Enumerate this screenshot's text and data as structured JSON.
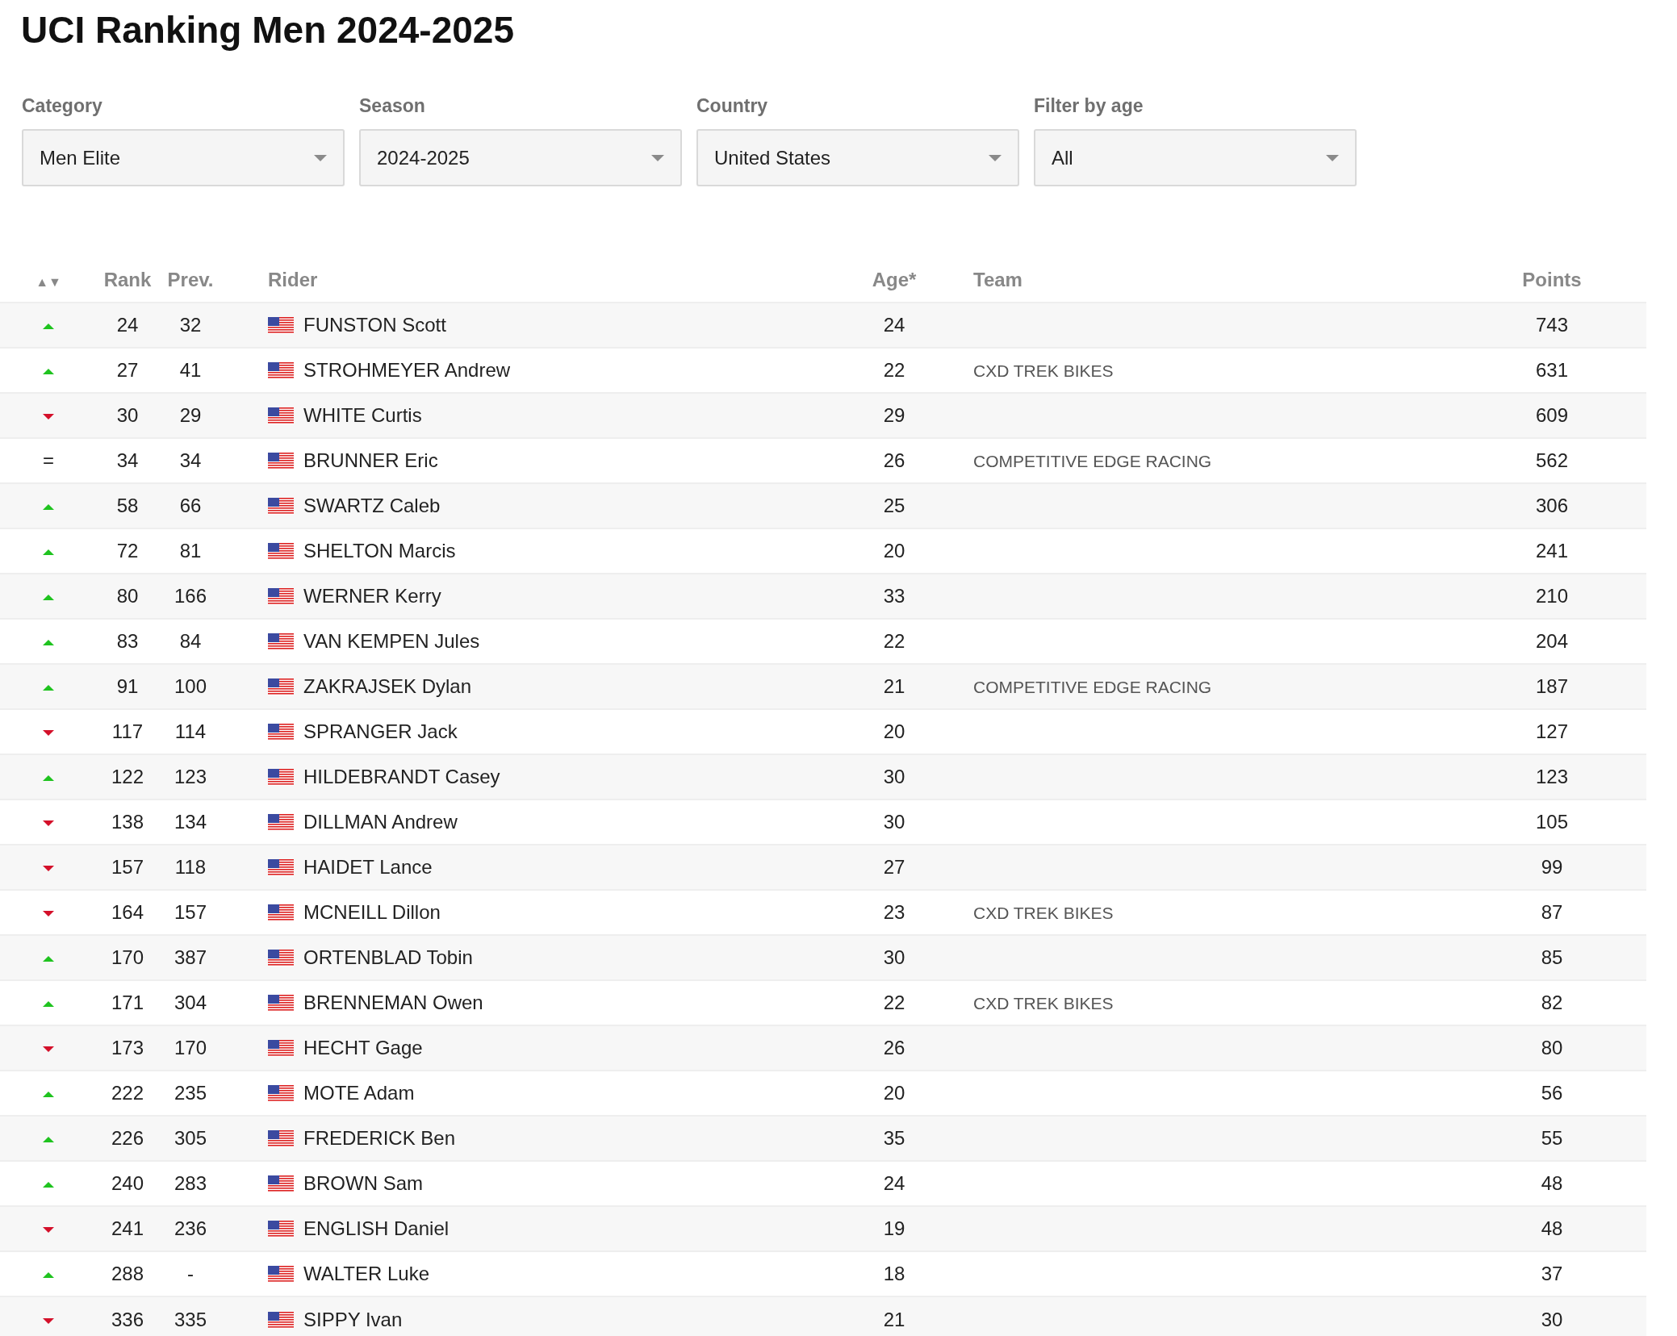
{
  "title": "UCI Ranking Men 2024-2025",
  "filters": [
    {
      "label": "Category",
      "value": "Men Elite"
    },
    {
      "label": "Season",
      "value": "2024-2025"
    },
    {
      "label": "Country",
      "value": "United States"
    },
    {
      "label": "Filter by age",
      "value": "All"
    }
  ],
  "table": {
    "columns": [
      "▲▼",
      "Rank",
      "Prev.",
      "Rider",
      "Age*",
      "Team",
      "Points"
    ],
    "rows": [
      {
        "kind": "up",
        "rank": "24",
        "prev": "32",
        "rider": "FUNSTON Scott",
        "age": "24",
        "points": "743"
      },
      {
        "kind": "up",
        "rank": "27",
        "prev": "41",
        "rider": "STROHMEYER Andrew",
        "age": "22",
        "team": "CXD TREK BIKES",
        "points": "631"
      },
      {
        "kind": "down",
        "rank": "30",
        "prev": "29",
        "rider": "WHITE Curtis",
        "age": "29",
        "points": "609"
      },
      {
        "kind": "equal",
        "trend_text": "=",
        "rank": "34",
        "prev": "34",
        "rider": "BRUNNER Eric",
        "age": "26",
        "team": "COMPETITIVE EDGE RACING",
        "points": "562"
      },
      {
        "kind": "up",
        "rank": "58",
        "prev": "66",
        "rider": "SWARTZ Caleb",
        "age": "25",
        "points": "306"
      },
      {
        "kind": "up",
        "rank": "72",
        "prev": "81",
        "rider": "SHELTON Marcis",
        "age": "20",
        "points": "241"
      },
      {
        "kind": "up",
        "rank": "80",
        "prev": "166",
        "rider": "WERNER Kerry",
        "age": "33",
        "points": "210"
      },
      {
        "kind": "up",
        "rank": "83",
        "prev": "84",
        "rider": "VAN KEMPEN Jules",
        "age": "22",
        "points": "204"
      },
      {
        "kind": "up",
        "rank": "91",
        "prev": "100",
        "rider": "ZAKRAJSEK Dylan",
        "age": "21",
        "team": "COMPETITIVE EDGE RACING",
        "points": "187"
      },
      {
        "kind": "down",
        "rank": "117",
        "prev": "114",
        "rider": "SPRANGER Jack",
        "age": "20",
        "points": "127"
      },
      {
        "kind": "up",
        "rank": "122",
        "prev": "123",
        "rider": "HILDEBRANDT Casey",
        "age": "30",
        "points": "123"
      },
      {
        "kind": "down",
        "rank": "138",
        "prev": "134",
        "rider": "DILLMAN Andrew",
        "age": "30",
        "points": "105"
      },
      {
        "kind": "down",
        "rank": "157",
        "prev": "118",
        "rider": "HAIDET Lance",
        "age": "27",
        "points": "99"
      },
      {
        "kind": "down",
        "rank": "164",
        "prev": "157",
        "rider": "MCNEILL Dillon",
        "age": "23",
        "team": "CXD TREK BIKES",
        "points": "87"
      },
      {
        "kind": "up",
        "rank": "170",
        "prev": "387",
        "rider": "ORTENBLAD Tobin",
        "age": "30",
        "points": "85"
      },
      {
        "kind": "up",
        "rank": "171",
        "prev": "304",
        "rider": "BRENNEMAN Owen",
        "age": "22",
        "team": "CXD TREK BIKES",
        "points": "82"
      },
      {
        "kind": "down",
        "rank": "173",
        "prev": "170",
        "rider": "HECHT Gage",
        "age": "26",
        "points": "80"
      },
      {
        "kind": "up",
        "rank": "222",
        "prev": "235",
        "rider": "MOTE Adam",
        "age": "20",
        "points": "56"
      },
      {
        "kind": "up",
        "rank": "226",
        "prev": "305",
        "rider": "FREDERICK Ben",
        "age": "35",
        "points": "55"
      },
      {
        "kind": "up",
        "rank": "240",
        "prev": "283",
        "rider": "BROWN Sam",
        "age": "24",
        "points": "48"
      },
      {
        "kind": "down",
        "rank": "241",
        "prev": "236",
        "rider": "ENGLISH Daniel",
        "age": "19",
        "points": "48"
      },
      {
        "kind": "up",
        "rank": "288",
        "prev": "-",
        "rider": "WALTER Luke",
        "age": "18",
        "points": "37"
      },
      {
        "kind": "down",
        "rank": "336",
        "prev": "335",
        "rider": "SIPPY Ivan",
        "age": "21",
        "points": "30"
      }
    ]
  }
}
